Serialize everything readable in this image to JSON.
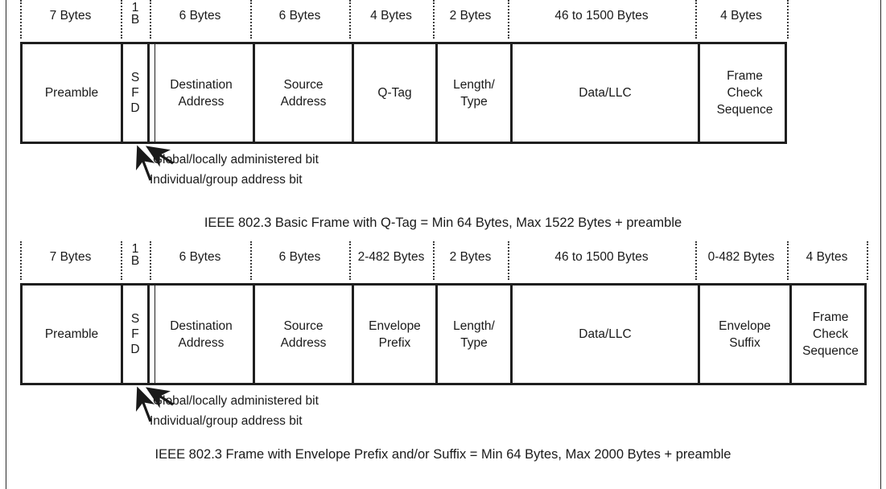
{
  "figures": [
    {
      "id": "basic-frame",
      "caption": "IEEE 802.3 Basic Frame with Q-Tag = Min 64 Bytes, Max 1522 Bytes + preamble",
      "fields": [
        {
          "name": "preamble",
          "size": "7 Bytes",
          "label": "Preamble"
        },
        {
          "name": "start-frame-delimiter",
          "size": "1 B",
          "label": "S F D"
        },
        {
          "name": "destination-address",
          "size": "6 Bytes",
          "label": "Destination Address"
        },
        {
          "name": "source-address",
          "size": "6 Bytes",
          "label": "Source Address"
        },
        {
          "name": "q-tag",
          "size": "4 Bytes",
          "label": "Q-Tag"
        },
        {
          "name": "length-type",
          "size": "2 Bytes",
          "label": "Length/ Type"
        },
        {
          "name": "data-llc",
          "size": "46 to 1500 Bytes",
          "label": "Data/LLC"
        },
        {
          "name": "frame-check-sequence",
          "size": "4 Bytes",
          "label": "Frame Check Sequence"
        }
      ],
      "callouts": [
        {
          "name": "global-locally-administered-bit",
          "label": "Global/locally administered bit"
        },
        {
          "name": "individual-group-address-bit",
          "label": "Individual/group address bit"
        }
      ]
    },
    {
      "id": "envelope-frame",
      "caption": "IEEE 802.3 Frame with Envelope Prefix and/or Suffix = Min 64 Bytes, Max 2000 Bytes + preamble",
      "fields": [
        {
          "name": "preamble",
          "size": "7 Bytes",
          "label": "Preamble"
        },
        {
          "name": "start-frame-delimiter",
          "size": "1 B",
          "label": "S F D"
        },
        {
          "name": "destination-address",
          "size": "6 Bytes",
          "label": "Destination Address"
        },
        {
          "name": "source-address",
          "size": "6 Bytes",
          "label": "Source Address"
        },
        {
          "name": "envelope-prefix",
          "size": "2-482 Bytes",
          "label": "Envelope Prefix"
        },
        {
          "name": "length-type",
          "size": "2 Bytes",
          "label": "Length/ Type"
        },
        {
          "name": "data-llc",
          "size": "46 to 1500 Bytes",
          "label": "Data/LLC"
        },
        {
          "name": "envelope-suffix",
          "size": "0-482 Bytes",
          "label": "Envelope Suffix"
        },
        {
          "name": "frame-check-sequence",
          "size": "4 Bytes",
          "label": "Frame Check Sequence"
        }
      ],
      "callouts": [
        {
          "name": "global-locally-administered-bit",
          "label": "Global/locally administered bit"
        },
        {
          "name": "individual-group-address-bit",
          "label": "Individual/group address bit"
        }
      ]
    }
  ]
}
